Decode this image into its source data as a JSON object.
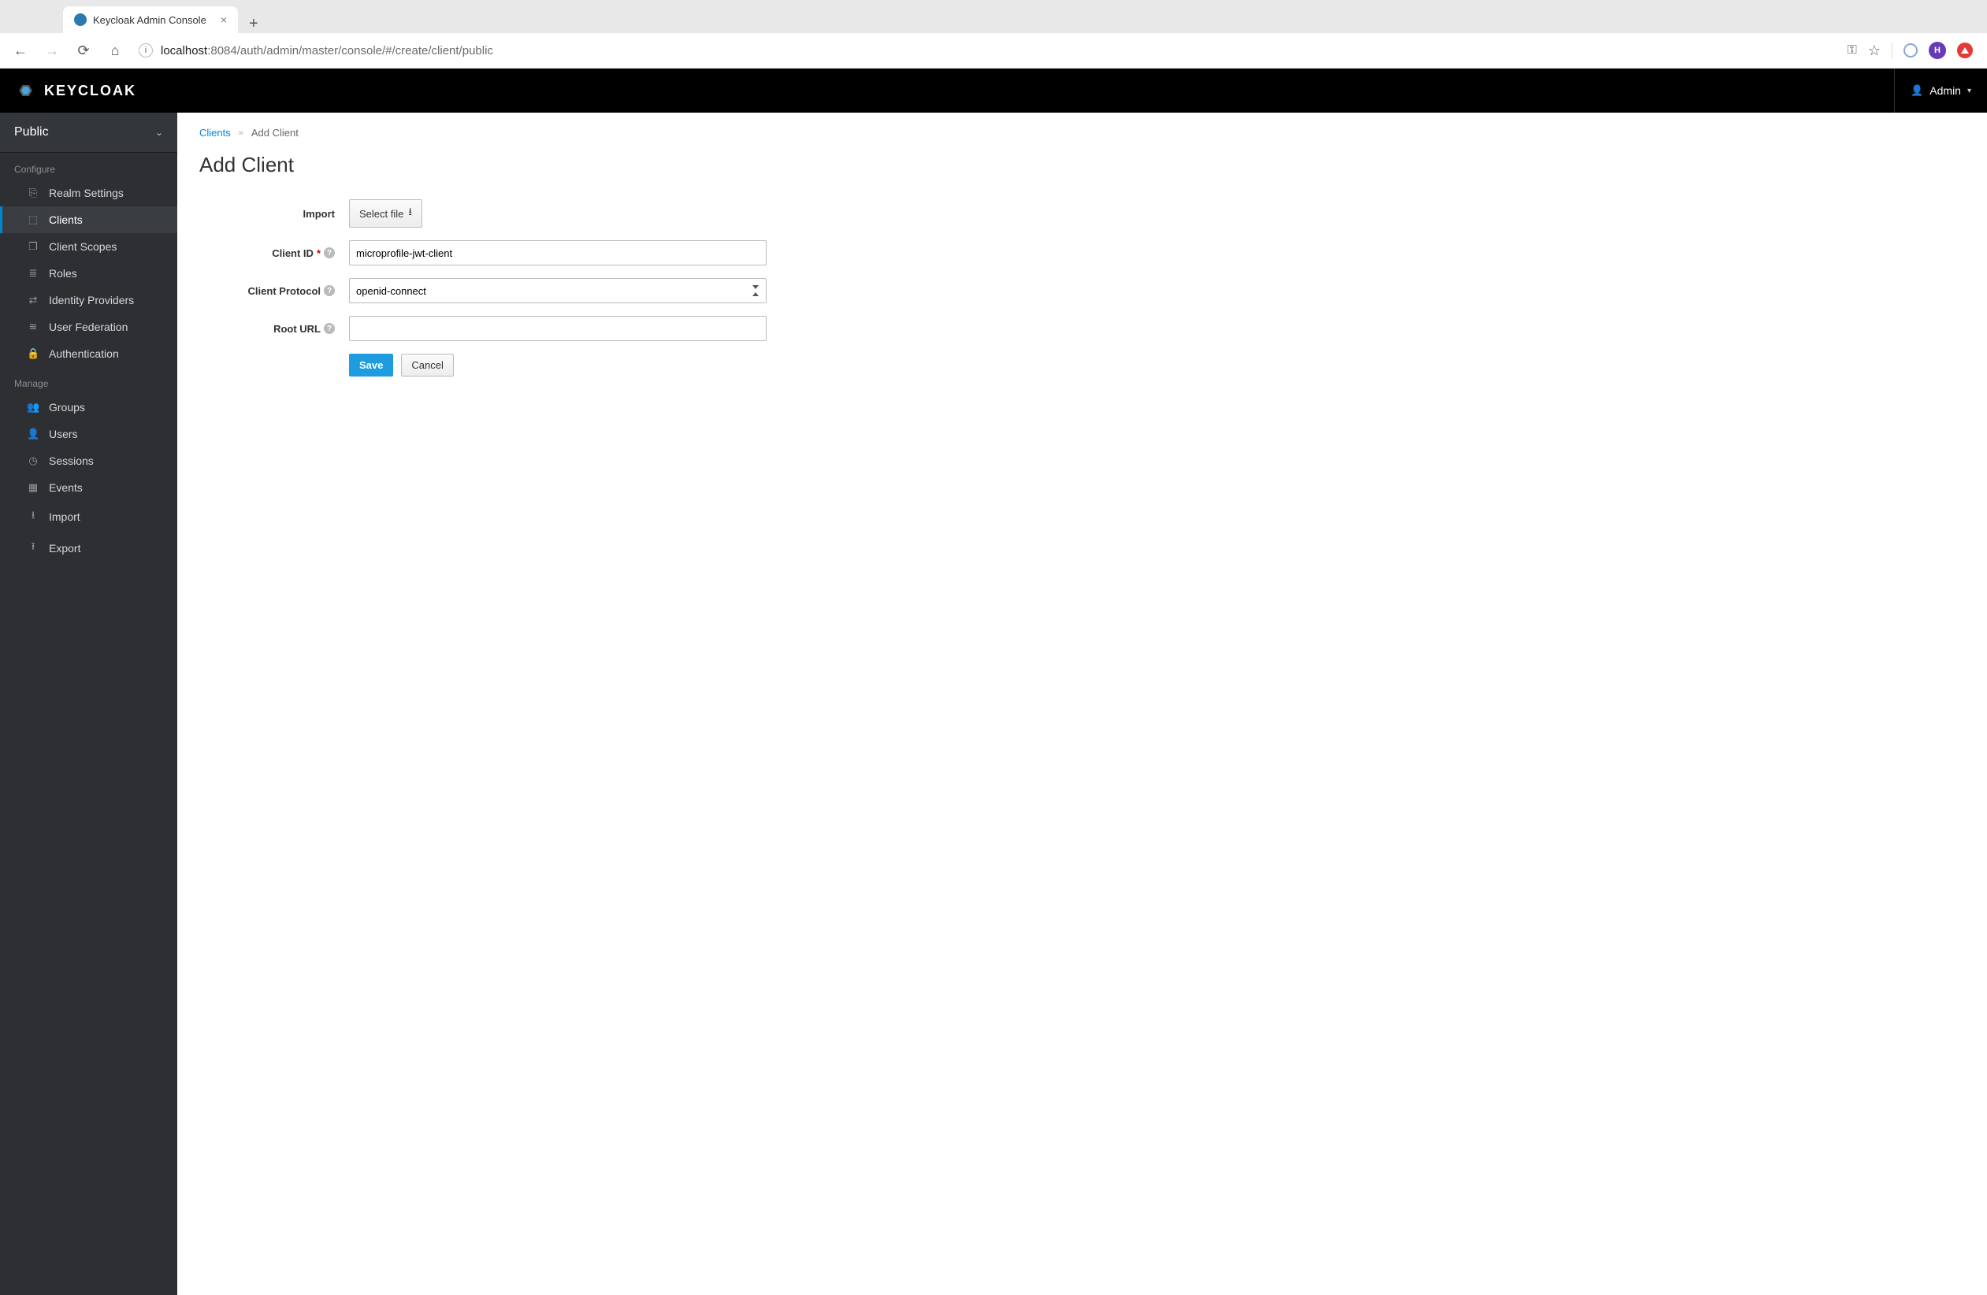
{
  "browser": {
    "tab_title": "Keycloak Admin Console",
    "url_host": "localhost",
    "url_rest": ":8084/auth/admin/master/console/#/create/client/public",
    "profile_initial": "H"
  },
  "header": {
    "brand": "KEYCLOAK",
    "user_label": "Admin"
  },
  "sidebar": {
    "realm_name": "Public",
    "sections": [
      {
        "label": "Configure",
        "items": [
          {
            "key": "realm-settings",
            "label": "Realm Settings",
            "icon": "⎘"
          },
          {
            "key": "clients",
            "label": "Clients",
            "icon": "⬚",
            "active": true
          },
          {
            "key": "client-scopes",
            "label": "Client Scopes",
            "icon": "❐"
          },
          {
            "key": "roles",
            "label": "Roles",
            "icon": "≣"
          },
          {
            "key": "idp",
            "label": "Identity Providers",
            "icon": "⇄"
          },
          {
            "key": "user-federation",
            "label": "User Federation",
            "icon": "≋"
          },
          {
            "key": "authentication",
            "label": "Authentication",
            "icon": "🔒"
          }
        ]
      },
      {
        "label": "Manage",
        "items": [
          {
            "key": "groups",
            "label": "Groups",
            "icon": "👥"
          },
          {
            "key": "users",
            "label": "Users",
            "icon": "👤"
          },
          {
            "key": "sessions",
            "label": "Sessions",
            "icon": "◷"
          },
          {
            "key": "events",
            "label": "Events",
            "icon": "▦"
          },
          {
            "key": "import",
            "label": "Import",
            "icon": "⭳"
          },
          {
            "key": "export",
            "label": "Export",
            "icon": "⭱"
          }
        ]
      }
    ]
  },
  "breadcrumb": {
    "parent": "Clients",
    "current": "Add Client"
  },
  "page": {
    "title": "Add Client",
    "import_label": "Import",
    "select_file_label": "Select file",
    "client_id_label": "Client ID",
    "client_id_value": "microprofile-jwt-client",
    "client_protocol_label": "Client Protocol",
    "client_protocol_value": "openid-connect",
    "root_url_label": "Root URL",
    "root_url_value": "",
    "save_label": "Save",
    "cancel_label": "Cancel"
  }
}
